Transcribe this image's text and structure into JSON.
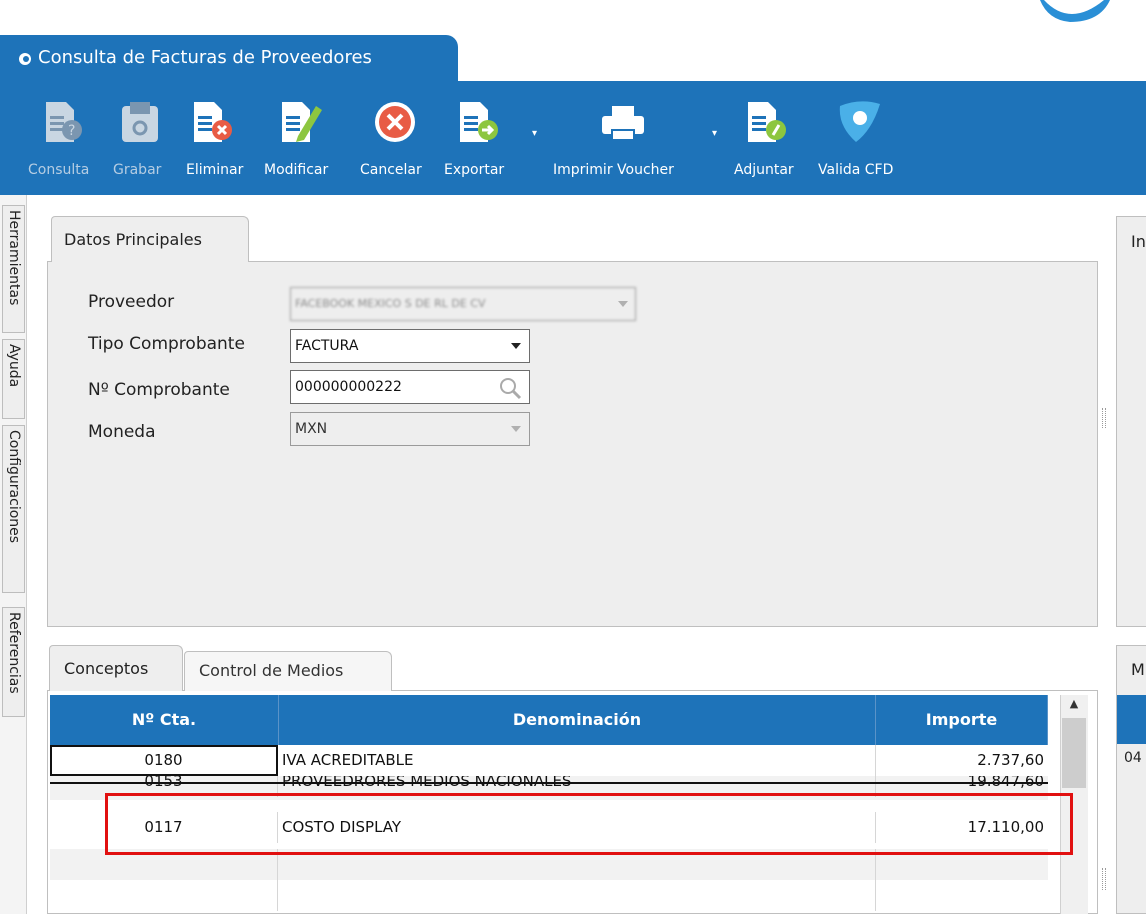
{
  "window": {
    "title": "Consulta de Facturas de Proveedores"
  },
  "toolbar": {
    "buttons": [
      {
        "label": "Consulta",
        "icon": "doc-help-icon",
        "enabled": false
      },
      {
        "label": "Grabar",
        "icon": "save-icon",
        "enabled": false
      },
      {
        "label": "Eliminar",
        "icon": "doc-delete-icon",
        "enabled": true
      },
      {
        "label": "Modificar",
        "icon": "doc-edit-icon",
        "enabled": true
      },
      {
        "label": "Cancelar",
        "icon": "cancel-icon",
        "enabled": true
      },
      {
        "label": "Exportar",
        "icon": "doc-export-icon",
        "enabled": true
      },
      {
        "label": "Imprimir Voucher",
        "icon": "printer-icon",
        "enabled": true
      },
      {
        "label": "Adjuntar",
        "icon": "doc-attach-icon",
        "enabled": true
      },
      {
        "label": "Valida CFD",
        "icon": "validate-icon",
        "enabled": true
      }
    ]
  },
  "side_tabs": [
    "Herramientas",
    "Ayuda",
    "Configuraciones",
    "Referencias"
  ],
  "datos": {
    "tab_label": "Datos Principales",
    "right_panel_label": "In",
    "fields": {
      "proveedor": {
        "label": "Proveedor",
        "value": "FACEBOOK MEXICO S DE RL DE CV"
      },
      "tipo": {
        "label": "Tipo Comprobante",
        "value": "FACTURA"
      },
      "numero": {
        "label": "Nº Comprobante",
        "value": "000000000222"
      },
      "moneda": {
        "label": "Moneda",
        "value": "MXN"
      }
    }
  },
  "conceptos": {
    "tabs": [
      "Conceptos",
      "Control de Medios"
    ],
    "right_panel_label": "M",
    "right_panel_cell": "04",
    "columns": [
      "Nº Cta.",
      "Denominación",
      "Importe"
    ],
    "rows": [
      {
        "cta": "0180",
        "denominacion": "IVA ACREDITABLE",
        "importe": "2.737,60"
      },
      {
        "cta": "0153",
        "denominacion": "PROVEEDRORES MEDIOS NACIONALES",
        "importe": "19.847,60"
      },
      {
        "cta": "0117",
        "denominacion": "COSTO DISPLAY",
        "importe": "17.110,00"
      },
      {
        "cta": "",
        "denominacion": "",
        "importe": ""
      },
      {
        "cta": "",
        "denominacion": "",
        "importe": ""
      }
    ]
  },
  "colors": {
    "accent": "#1e73b9",
    "panel": "#eeeeee",
    "highlight": "#e11010"
  }
}
